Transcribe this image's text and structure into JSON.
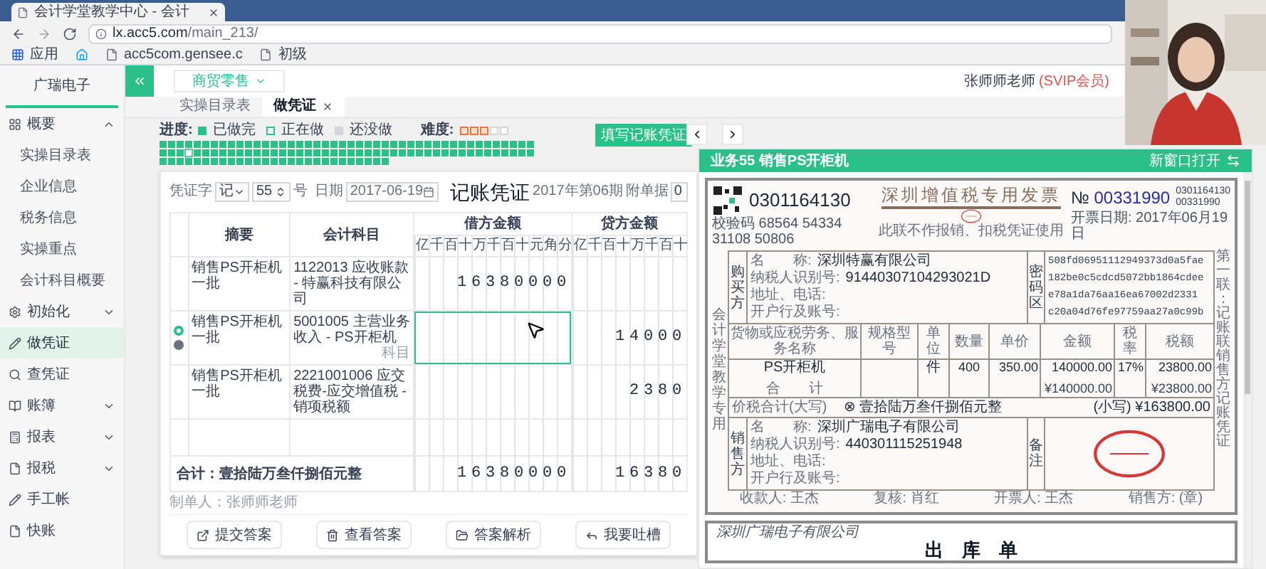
{
  "browser": {
    "tab_title": "会计学堂教学中心 - 会计",
    "url_host": "lx.acc5.com",
    "url_path": "/main_213/",
    "bookmarks": [
      {
        "kind": "apps",
        "label": "应用"
      },
      {
        "kind": "home"
      },
      {
        "kind": "page",
        "label": "acc5com.gensee.c"
      },
      {
        "kind": "page",
        "label": "初级"
      }
    ]
  },
  "sidebar": {
    "company": "广瑞电子",
    "items": [
      {
        "label": "概要",
        "expanded": true,
        "selected": false,
        "children": [
          {
            "label": "实操目录表",
            "selected": false
          },
          {
            "label": "企业信息",
            "selected": false
          },
          {
            "label": "税务信息",
            "selected": false
          },
          {
            "label": "实操重点",
            "selected": false
          },
          {
            "label": "会计科目概要",
            "selected": false
          }
        ]
      },
      {
        "label": "初始化",
        "expanded": false,
        "selected": false
      },
      {
        "label": "做凭证",
        "selected": true
      },
      {
        "label": "查凭证",
        "selected": false
      },
      {
        "label": "账簿",
        "expanded": false,
        "selected": false
      },
      {
        "label": "报表",
        "expanded": false,
        "selected": false
      },
      {
        "label": "报税",
        "expanded": false,
        "selected": false
      },
      {
        "label": "手工帐",
        "selected": false
      },
      {
        "label": "快账",
        "selected": false
      }
    ]
  },
  "header": {
    "industry": "商贸零售",
    "user": "张师师老师",
    "badge": "(SVIP会员)"
  },
  "tabs": [
    {
      "label": "实操目录表",
      "selected": false,
      "closable": false
    },
    {
      "label": "做凭证",
      "selected": true,
      "closable": true
    }
  ],
  "progress": {
    "label": "进度:",
    "legend": [
      {
        "kind": "done",
        "label": "已做完"
      },
      {
        "kind": "current",
        "label": "正在做"
      },
      {
        "kind": "todo",
        "label": "还没做"
      }
    ],
    "difficulty_label": "难度:",
    "stars": 3,
    "squares": [
      {
        "kind": "done"
      },
      {
        "kind": "done"
      },
      {
        "kind": "done"
      },
      {
        "kind": "done"
      },
      {
        "kind": "done"
      },
      {
        "kind": "done"
      },
      {
        "kind": "done"
      },
      {
        "kind": "done"
      },
      {
        "kind": "done"
      },
      {
        "kind": "done"
      },
      {
        "kind": "done"
      },
      {
        "kind": "done"
      },
      {
        "kind": "done"
      },
      {
        "kind": "done"
      },
      {
        "kind": "done"
      },
      {
        "kind": "done"
      },
      {
        "kind": "done"
      },
      {
        "kind": "done"
      },
      {
        "kind": "done"
      },
      {
        "kind": "done"
      },
      {
        "kind": "done"
      },
      {
        "kind": "done"
      },
      {
        "kind": "done"
      },
      {
        "kind": "done"
      },
      {
        "kind": "done"
      },
      {
        "kind": "done"
      },
      {
        "kind": "done"
      },
      {
        "kind": "done"
      },
      {
        "kind": "done"
      },
      {
        "kind": "done"
      },
      {
        "kind": "done"
      },
      {
        "kind": "done"
      },
      {
        "kind": "done"
      },
      {
        "kind": "done"
      },
      {
        "kind": "done"
      },
      {
        "kind": "done"
      },
      {
        "kind": "done"
      },
      {
        "kind": "done"
      },
      {
        "kind": "done"
      },
      {
        "kind": "done"
      },
      {
        "kind": "done"
      },
      {
        "kind": "done"
      },
      {
        "kind": "done"
      },
      {
        "kind": "done"
      },
      {
        "kind": "done"
      },
      {
        "kind": "done"
      },
      {
        "kind": "done"
      },
      {
        "kind": "current"
      },
      {
        "kind": "done"
      },
      {
        "kind": "done"
      },
      {
        "kind": "done"
      },
      {
        "kind": "done"
      },
      {
        "kind": "done"
      },
      {
        "kind": "done"
      },
      {
        "kind": "done"
      },
      {
        "kind": "done"
      },
      {
        "kind": "done"
      },
      {
        "kind": "done"
      },
      {
        "kind": "done"
      },
      {
        "kind": "done"
      },
      {
        "kind": "done"
      },
      {
        "kind": "done"
      },
      {
        "kind": "done"
      },
      {
        "kind": "done"
      },
      {
        "kind": "done"
      },
      {
        "kind": "done"
      },
      {
        "kind": "done"
      },
      {
        "kind": "done"
      },
      {
        "kind": "done"
      },
      {
        "kind": "done"
      },
      {
        "kind": "done"
      },
      {
        "kind": "done"
      },
      {
        "kind": "done"
      },
      {
        "kind": "done"
      },
      {
        "kind": "done"
      },
      {
        "kind": "done"
      },
      {
        "kind": "done"
      },
      {
        "kind": "done"
      },
      {
        "kind": "done"
      },
      {
        "kind": "done"
      },
      {
        "kind": "done"
      },
      {
        "kind": "done"
      },
      {
        "kind": "done"
      },
      {
        "kind": "done"
      },
      {
        "kind": "done"
      },
      {
        "kind": "done"
      },
      {
        "kind": "done"
      },
      {
        "kind": "done"
      },
      {
        "kind": "done"
      },
      {
        "kind": "done"
      },
      {
        "kind": "done"
      },
      {
        "kind": "done"
      },
      {
        "kind": "done"
      },
      {
        "kind": "done"
      },
      {
        "kind": "done"
      },
      {
        "kind": "done"
      },
      {
        "kind": "done"
      },
      {
        "kind": "done"
      },
      {
        "kind": "done"
      },
      {
        "kind": "done"
      },
      {
        "kind": "done"
      },
      {
        "kind": "done"
      },
      {
        "kind": "done"
      },
      {
        "kind": "done"
      },
      {
        "kind": "done"
      },
      {
        "kind": "done"
      },
      {
        "kind": "done"
      },
      {
        "kind": "done"
      },
      {
        "kind": "done"
      },
      {
        "kind": "done"
      },
      {
        "kind": "done"
      },
      {
        "kind": "done"
      },
      {
        "kind": "done"
      },
      {
        "kind": "done"
      },
      {
        "kind": "done"
      }
    ]
  },
  "fill_button": "填写记账凭证",
  "voucher": {
    "word_label": "凭证字",
    "word": "记",
    "number": "55",
    "number_suffix": "号",
    "date_label": "日期",
    "date": "2017-06-19",
    "title": "记账凭证",
    "period": "2017年第06期",
    "attachments_label": "附单据",
    "attachments": "0",
    "columns": {
      "summary": "摘要",
      "account": "会计科目",
      "debit": "借方金额",
      "credit": "贷方金额"
    },
    "debit_digits": [
      "亿",
      "千",
      "百",
      "十",
      "万",
      "千",
      "百",
      "十",
      "元",
      "角",
      "分"
    ],
    "credit_digits": [
      "亿",
      "千",
      "百",
      "十",
      "万",
      "千",
      "百",
      "十"
    ],
    "rows": [
      {
        "summary": "销售PS开柜机一批",
        "account": "1122013 应收账款 - 特赢科技有限公司",
        "debit": "16380000",
        "selected": false
      },
      {
        "summary": "销售PS开柜机一批",
        "account": "5001005 主营业务收入 - PS开柜机",
        "account_hint": "科目",
        "credit": "14000",
        "selected": true
      },
      {
        "summary": "销售PS开柜机一批",
        "account": "2221001006 应交税费-应交增值税 - 销项税额",
        "credit": "2380",
        "selected": false
      },
      {
        "selected": false
      }
    ],
    "total": {
      "label": "合计：壹拾陆万叁仟捌佰元整",
      "debit": "16380000",
      "credit": "16380"
    },
    "maker": "制单人：张师师老师",
    "buttons": [
      {
        "label": "提交答案"
      },
      {
        "label": "查看答案"
      },
      {
        "label": "答案解析"
      },
      {
        "label": "我要吐槽"
      }
    ]
  },
  "panel": {
    "title": "业务55 销售PS开柜机",
    "open_new": "新窗口打开"
  },
  "invoice": {
    "code": "0301164130",
    "check_code": "校验码 68564 54334 31108 50806",
    "title": "深圳增值税专用发票",
    "note": "此联不作报销、扣税凭证使用",
    "no_label": "№",
    "no": "00331990",
    "code_small": "0301164130",
    "no_small": "00331990",
    "date": "开票日期: 2017年06月19日",
    "side_left": "会计学堂教学专用",
    "side_right": "第一联：记账联销售方记账凭证",
    "buyer": {
      "label": "购买方",
      "fields": [
        {
          "label": "名　　称:",
          "value": "深圳特赢有限公司"
        },
        {
          "label": "纳税人识别号:",
          "value": "91440307104293021D"
        },
        {
          "label": "地址、电话:"
        },
        {
          "label": "开户行及账号:"
        }
      ]
    },
    "cipher_label": "密码区",
    "cipher": [
      "508fd06951112949373d0a5fae",
      "182be0c5cdcd5072bb1864cdee",
      "e78a1da76aa16ea67002d2331",
      "c20a04d76fe97759aa27a0c99b"
    ],
    "item_headers": [
      "货物或应税劳务、服务名称",
      "规格型号",
      "单位",
      "数量",
      "单价",
      "金额",
      "税率",
      "税额"
    ],
    "items": [
      {
        "name": "PS开柜机",
        "unit": "件",
        "quantity": "400",
        "price": "350.00",
        "amount": "140000.00",
        "rate": "17%",
        "tax": "23800.00"
      }
    ],
    "subtotal_label": "合　　计",
    "subtotal_amount": "¥140000.00",
    "subtotal_tax": "¥23800.00",
    "total_label": "价税合计(大写)",
    "total_words": "⊗ 壹拾陆万叁仟捌佰元整",
    "total_figure": "(小写) ¥163800.00",
    "seller": {
      "label": "销售方",
      "fields": [
        {
          "label": "名　　称:",
          "value": "深圳广瑞电子有限公司"
        },
        {
          "label": "纳税人识别号:",
          "value": "440301115251948"
        },
        {
          "label": "地址、电话:"
        },
        {
          "label": "开户行及账号:"
        }
      ]
    },
    "remarks_label": "备注",
    "footer": [
      "收款人: 王杰",
      "复核: 肖红",
      "开票人: 王杰",
      "销售方: (章)"
    ]
  },
  "stock_out": {
    "company": "深圳广瑞电子有限公司",
    "title": "出　库　单"
  }
}
